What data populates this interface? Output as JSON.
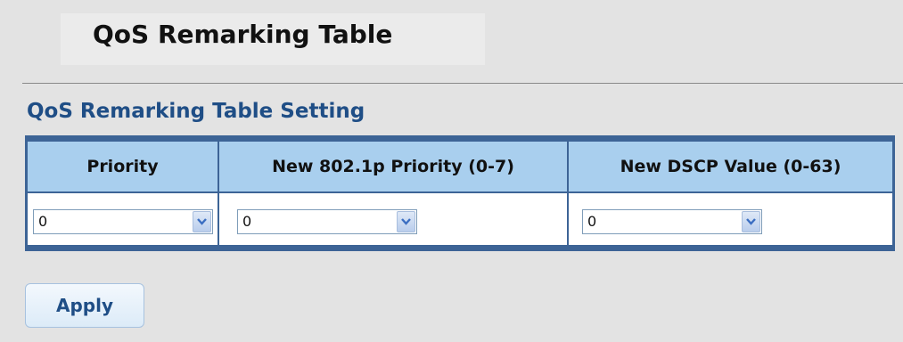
{
  "page": {
    "title": "QoS Remarking Table",
    "section_title": "QoS Remarking Table Setting"
  },
  "table": {
    "headers": [
      "Priority",
      "New 802.1p Priority (0-7)",
      "New DSCP Value (0-63)"
    ],
    "selects": [
      {
        "name": "priority",
        "value": "0",
        "icon": "chevron-down-icon"
      },
      {
        "name": "new-8021p-priority",
        "value": "0",
        "icon": "chevron-down-icon"
      },
      {
        "name": "new-dscp-value",
        "value": "0",
        "icon": "chevron-down-icon"
      }
    ]
  },
  "actions": {
    "apply_label": "Apply"
  },
  "colors": {
    "header_background": "#a9cfee",
    "table_border": "#3d6496",
    "section_title": "#1f4e86",
    "page_background": "#e3e3e3"
  }
}
